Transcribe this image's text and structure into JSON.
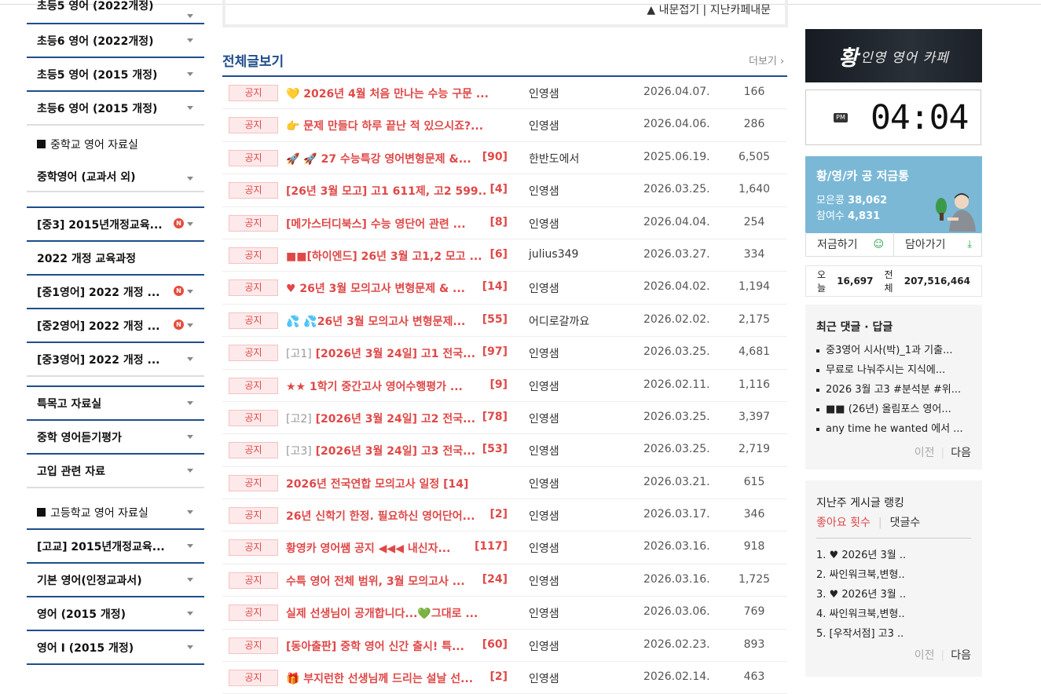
{
  "sidebar": {
    "items": [
      {
        "label": "초등5 영어 (2022개정)"
      },
      {
        "label": "초등6 영어 (2022개정)"
      },
      {
        "label": "초등5 영어 (2015 개정)"
      },
      {
        "label": "초등6 영어 (2015 개정)"
      },
      {
        "label": "중학교 영어 자료실"
      },
      {
        "label": "중학영어 (교과서 외)"
      },
      {
        "label": "[중3] 2015년개정교육..."
      },
      {
        "label": "2022 개정 교육과정"
      },
      {
        "label": "[중1영어] 2022 개정 ..."
      },
      {
        "label": "[중2영어] 2022 개정 ..."
      },
      {
        "label": "[중3영어] 2022 개정 ..."
      },
      {
        "label": "특목고 자료실"
      },
      {
        "label": "중학 영어듣기평가"
      },
      {
        "label": "고입 관련 자료"
      },
      {
        "label": "고등학교 영어 자료실"
      },
      {
        "label": "[고교] 2015년개정교육..."
      },
      {
        "label": "기본 영어(인정교과서)"
      },
      {
        "label": "영어 (2015 개정)"
      },
      {
        "label": "영어 I (2015 개정)"
      }
    ],
    "new_badge": "N"
  },
  "top": {
    "fold_link": "▲ 내문접기 | 지난카페내문"
  },
  "board": {
    "title": "전체글보기",
    "more": "더보기 ›",
    "notice_label": "공지",
    "rows": [
      {
        "title": "💛 2026년 4월 처음 만나는 수능 구문 ...",
        "count": "",
        "author": "인영샘",
        "date": "2026.04.07.",
        "views": "166"
      },
      {
        "title": "👉 문제 만들다 하루 끝난 적 있으시죠?...",
        "count": "",
        "author": "인영샘",
        "date": "2026.04.06.",
        "views": "286"
      },
      {
        "title": "🚀 🚀 27 수능특강 영어변형문제 &...",
        "count": "[90]",
        "author": "한반도에서",
        "date": "2025.06.19.",
        "views": "6,505"
      },
      {
        "title": "[26년 3월 모고] 고1 611제, 고2 599...",
        "count": "[4]",
        "author": "인영샘",
        "date": "2026.03.25.",
        "views": "1,640"
      },
      {
        "title": "[메가스터디북스] 수능 영단어 관련 ...",
        "count": "[8]",
        "author": "인영샘",
        "date": "2026.04.04.",
        "views": "254"
      },
      {
        "title": "■■[하이엔드] 26년 3월 고1,2 모고 ...",
        "count": "[6]",
        "author": "julius349",
        "date": "2026.03.27.",
        "views": "334"
      },
      {
        "title": "♥ 26년 3월 모의고사 변형문제 & ...",
        "count": "[14]",
        "author": "인영샘",
        "date": "2026.04.02.",
        "views": "1,194"
      },
      {
        "title": "💦 💦26년 3월 모의고사 변형문제...",
        "count": "[55]",
        "author": "어디로갈까요",
        "date": "2026.02.02.",
        "views": "2,175"
      },
      {
        "prefix": "[고1]",
        "title": " [2026년 3월 24일] 고1 전국...",
        "count": "[97]",
        "author": "인영샘",
        "date": "2026.03.25.",
        "views": "4,681"
      },
      {
        "title": "★★ 1학기 중간고사 영어수행평가 ...",
        "count": "[9]",
        "author": "인영샘",
        "date": "2026.02.11.",
        "views": "1,116"
      },
      {
        "prefix": "[고2]",
        "title": " [2026년 3월 24일] 고2 전국...",
        "count": "[78]",
        "author": "인영샘",
        "date": "2026.03.25.",
        "views": "3,397"
      },
      {
        "prefix": "[고3]",
        "title": " [2026년 3월 24일] 고3 전국...",
        "count": "[53]",
        "author": "인영샘",
        "date": "2026.03.25.",
        "views": "2,719"
      },
      {
        "title": "2026년 전국연합 모의고사 일정 [14]",
        "count": "",
        "author": "인영샘",
        "date": "2026.03.21.",
        "views": "615"
      },
      {
        "title": "26년 신학기 한정. 필요하신 영어단어...",
        "count": "[2]",
        "author": "인영샘",
        "date": "2026.03.17.",
        "views": "346"
      },
      {
        "title": "황영카 영어쌤 공지 ◀◀◀ 내신자...",
        "count": "[117]",
        "author": "인영샘",
        "date": "2026.03.16.",
        "views": "918"
      },
      {
        "title": "수특 영어 전체 범위, 3월 모의고사 ...",
        "count": "[24]",
        "author": "인영샘",
        "date": "2026.03.16.",
        "views": "1,725"
      },
      {
        "title": "실제 선생님이 공개합니다...💚그대로 ...",
        "count": "",
        "author": "인영샘",
        "date": "2026.03.06.",
        "views": "769"
      },
      {
        "title": "[동아출판] 중학 영어 신간 출시! 특...",
        "count": "[60]",
        "author": "인영샘",
        "date": "2026.02.23.",
        "views": "893"
      },
      {
        "title": "🎁 부지런한 선생님께 드리는 설날 선...",
        "count": "[2]",
        "author": "인영샘",
        "date": "2026.02.14.",
        "views": "463"
      }
    ]
  },
  "right": {
    "logo_big": "황",
    "logo_rest": "인영 영어 카페",
    "clock": {
      "ampm": "PM",
      "time": "04:04"
    },
    "saving": {
      "heading": "황/영/카 공 저금통",
      "collected_label": "모은콩",
      "collected": "38,062",
      "participants_label": "참여수",
      "participants": "4,831",
      "save_btn": "저금하기",
      "bookmark_btn": "담아가기"
    },
    "visits": {
      "today_label": "오늘",
      "today": "16,697",
      "total_label": "전체",
      "total": "207,516,464"
    },
    "comments": {
      "heading": "최근 댓글 · 답글",
      "items": [
        "중3영어 시사(박)_1과 기출...",
        "무료로 나눠주시는 지식에...",
        "2026 3월 고3 #분석분 #위...",
        "■■ (26년) 올림포스 영어...",
        "any time he wanted 에서 ..."
      ],
      "prev": "이전",
      "next": "다음"
    },
    "ranking": {
      "heading": "지난주 게시글 랭킹",
      "tab_likes": "좋아요 횟수",
      "tab_comments": "댓글수",
      "items": [
        "1. ♥ 2026년 3월 ..",
        "2. 싸인워크북,변형..",
        "3. ♥ 2026년 3월 ..",
        "4. 싸인워크북,변형..",
        "5. [우작서점] 고3 .."
      ],
      "prev": "이전",
      "next": "다음"
    }
  },
  "colors": {
    "accent": "#1e4d8c",
    "notice_red": "#e04848",
    "sky": "#7ab8d6"
  }
}
